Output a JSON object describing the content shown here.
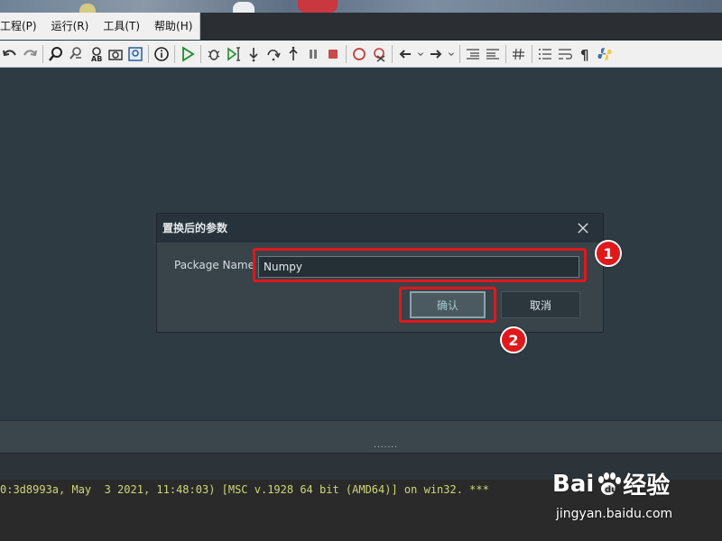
{
  "menubar": {
    "items": [
      {
        "label": "工程(P)"
      },
      {
        "label": "运行(R)"
      },
      {
        "label": "工具(T)"
      },
      {
        "label": "帮助(H)"
      }
    ]
  },
  "toolbar": {
    "icons": [
      "undo-icon",
      "redo-icon",
      "find-icon",
      "find-in-files-icon",
      "replace-icon",
      "screenshot-icon",
      "zoom-icon",
      "info-icon",
      "run-icon",
      "debug-icon",
      "run-to-cursor-icon",
      "step-into-icon",
      "step-over-icon",
      "step-out-icon",
      "pause-icon",
      "stop-icon",
      "breakpoint-icon",
      "clear-breakpoints-icon",
      "back-icon",
      "back-dropdown-icon",
      "forward-icon",
      "forward-dropdown-icon",
      "indent-icon",
      "unindent-icon",
      "comment-icon",
      "list-icon",
      "wrap-icon",
      "pilcrow-icon",
      "python-icon"
    ]
  },
  "dialog": {
    "title": "置换后的参数",
    "field_label": "Package Name",
    "field_value": "Numpy",
    "ok_label": "确认",
    "cancel_label": "取消"
  },
  "annotations": {
    "marker1": "1",
    "marker2": "2"
  },
  "console": {
    "line": "0:3d8993a, May  3 2021, 11:48:03) [MSC v.1928 64 bit (AMD64)] on win32. ***"
  },
  "splitter": {
    "grip": "......."
  },
  "watermark": {
    "brand": "Bai",
    "brand2": "经验",
    "url": "jingyan.baidu.com"
  },
  "colors": {
    "accent_red": "#e0181c",
    "editor_bg": "#2f3b42",
    "console_text": "#cdd876"
  }
}
